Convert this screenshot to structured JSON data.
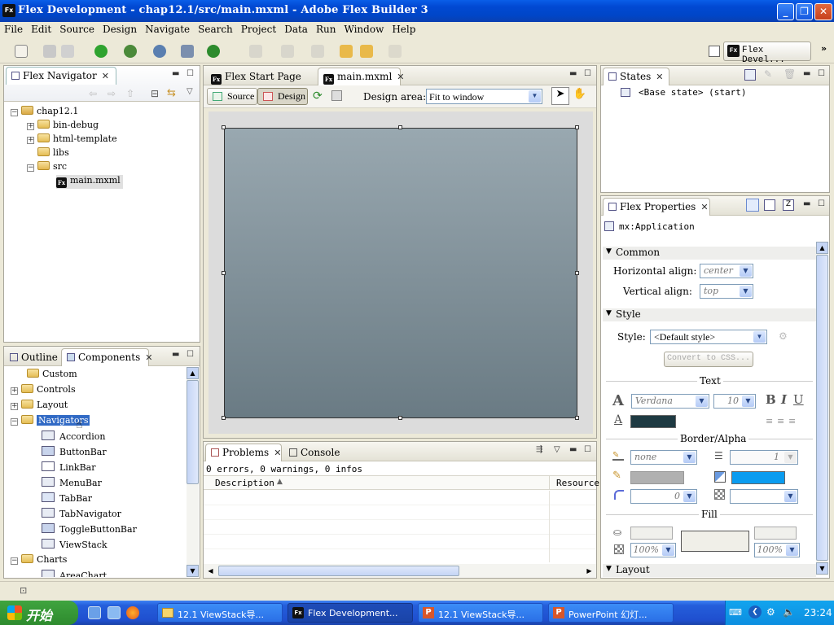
{
  "window": {
    "title": "Flex Development - chap12.1/src/main.mxml - Adobe Flex Builder 3",
    "app_icon": "Fx"
  },
  "menu": [
    "File",
    "Edit",
    "Source",
    "Design",
    "Navigate",
    "Search",
    "Project",
    "Data",
    "Run",
    "Window",
    "Help"
  ],
  "perspective": {
    "label": "Flex Devel..."
  },
  "navigator": {
    "tab": "Flex Navigator",
    "tree": [
      {
        "label": "chap12.1",
        "level": 0
      },
      {
        "label": "bin-debug",
        "level": 1
      },
      {
        "label": "html-template",
        "level": 1
      },
      {
        "label": "libs",
        "level": 1
      },
      {
        "label": "src",
        "level": 1
      },
      {
        "label": "main.mxml",
        "level": 2
      }
    ]
  },
  "editor": {
    "tabs": [
      "Flex Start Page",
      "main.mxml"
    ],
    "source_label": "Source",
    "design_label": "Design",
    "design_area_label": "Design area:",
    "design_area_value": "Fit to window"
  },
  "components": {
    "tabs": [
      "Outline",
      "Components"
    ],
    "items": [
      {
        "label": "Custom",
        "type": "folder",
        "level": 0
      },
      {
        "label": "Controls",
        "type": "folder",
        "level": 0
      },
      {
        "label": "Layout",
        "type": "folder",
        "level": 0
      },
      {
        "label": "Navigators",
        "type": "folder",
        "level": 0,
        "selected": true
      },
      {
        "label": "Accordion",
        "type": "component",
        "level": 1
      },
      {
        "label": "ButtonBar",
        "type": "component",
        "level": 1
      },
      {
        "label": "LinkBar",
        "type": "component",
        "level": 1
      },
      {
        "label": "MenuBar",
        "type": "component",
        "level": 1
      },
      {
        "label": "TabBar",
        "type": "component",
        "level": 1
      },
      {
        "label": "TabNavigator",
        "type": "component",
        "level": 1
      },
      {
        "label": "ToggleButtonBar",
        "type": "component",
        "level": 1
      },
      {
        "label": "ViewStack",
        "type": "component",
        "level": 1
      },
      {
        "label": "Charts",
        "type": "folder",
        "level": 0
      },
      {
        "label": "AreaChart",
        "type": "component",
        "level": 1
      }
    ]
  },
  "problems": {
    "tabs": [
      "Problems",
      "Console"
    ],
    "summary": "0 errors, 0 warnings, 0 infos",
    "columns": [
      "Description",
      "Resource"
    ]
  },
  "states": {
    "tab": "States",
    "items": [
      "<Base state> (start)"
    ]
  },
  "properties": {
    "tab": "Flex Properties",
    "target": "mx:Application",
    "common": {
      "title": "Common",
      "halign_label": "Horizontal align:",
      "halign_value": "center",
      "valign_label": "Vertical align:",
      "valign_value": "top"
    },
    "style": {
      "title": "Style",
      "style_label": "Style:",
      "style_value": "<Default style>",
      "convert_button": "Convert to CSS...",
      "text_title": "Text",
      "font": "Verdana",
      "size": "10",
      "bold": "B",
      "italic": "I",
      "underline": "U",
      "text_color": "#1e3a42",
      "border_title": "Border/Alpha",
      "border_style": "none",
      "border_thickness": "1",
      "border_color": "#b0b0b0",
      "theme_color": "#0a9cf0",
      "corner_radius": "0",
      "fill_title": "Fill",
      "fill_alpha_1": "100%",
      "fill_alpha_2": "100%"
    },
    "layout_title": "Layout"
  },
  "taskbar": {
    "start": "开始",
    "tasks": [
      "12.1 ViewStack导...",
      "Flex Development...",
      "12.1 ViewStack导...",
      "PowerPoint 幻灯..."
    ],
    "clock": "23:24"
  }
}
